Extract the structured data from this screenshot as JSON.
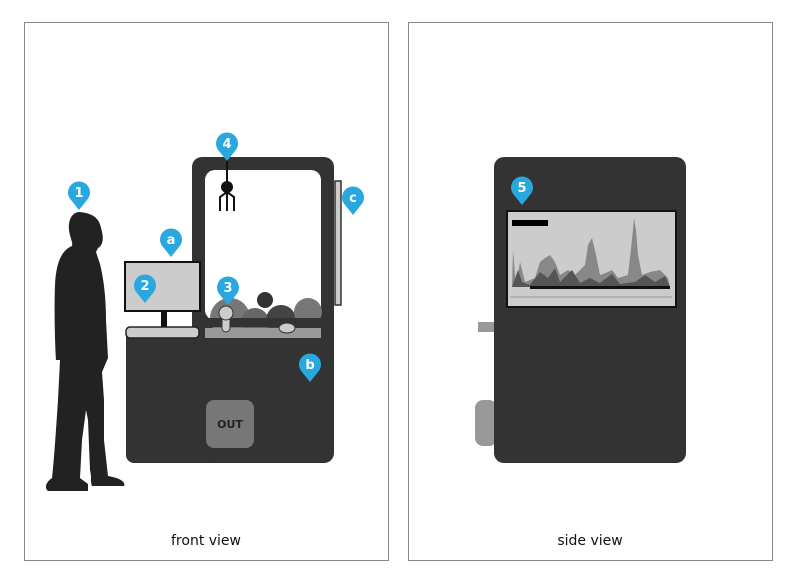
{
  "colors": {
    "marker": "#29a8e0",
    "machine": "#333333",
    "screen": "#cccccc",
    "panel_border": "#888888"
  },
  "front_view": {
    "caption": "front view",
    "out_label": "OUT",
    "markers": [
      "1",
      "2",
      "a",
      "3",
      "4",
      "c",
      "b"
    ]
  },
  "side_view": {
    "caption": "side view",
    "markers": [
      "5"
    ]
  }
}
